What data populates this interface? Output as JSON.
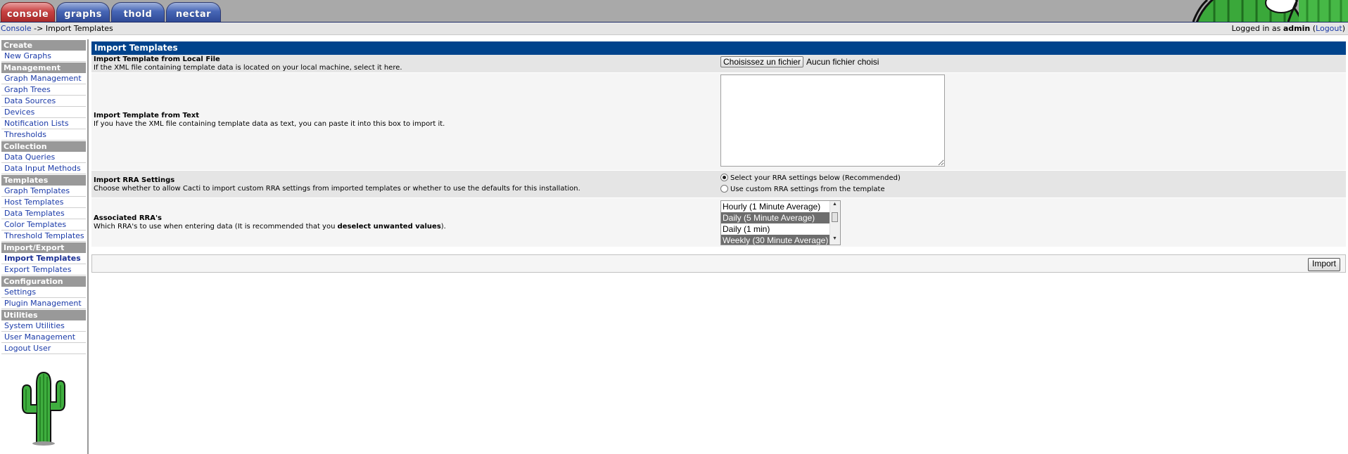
{
  "tabs": [
    {
      "label": "console",
      "color": "#c84242"
    },
    {
      "label": "graphs",
      "color": "#4766b6"
    },
    {
      "label": "thold",
      "color": "#4766b6"
    },
    {
      "label": "nectar",
      "color": "#4766b6"
    }
  ],
  "breadcrumb": {
    "root": "Console",
    "separator": " -> ",
    "current": "Import Templates"
  },
  "session": {
    "prefix": "Logged in as ",
    "user": "admin",
    "logout_open": " (",
    "logout": "Logout",
    "logout_close": ")"
  },
  "sidebar": {
    "sections": [
      {
        "header": "Create",
        "items": [
          "New Graphs"
        ]
      },
      {
        "header": "Management",
        "items": [
          "Graph Management",
          "Graph Trees",
          "Data Sources",
          "Devices",
          "Notification Lists",
          "Thresholds"
        ]
      },
      {
        "header": "Collection Methods",
        "items": [
          "Data Queries",
          "Data Input Methods"
        ]
      },
      {
        "header": "Templates",
        "items": [
          "Graph Templates",
          "Host Templates",
          "Data Templates",
          "Color Templates",
          "Threshold Templates"
        ]
      },
      {
        "header": "Import/Export",
        "items": [
          "Import Templates",
          "Export Templates"
        ]
      },
      {
        "header": "Configuration",
        "items": [
          "Settings",
          "Plugin Management"
        ]
      },
      {
        "header": "Utilities",
        "items": [
          "System Utilities",
          "User Management",
          "Logout User"
        ]
      }
    ],
    "active": "Import Templates"
  },
  "panel": {
    "title": "Import Templates",
    "local_file": {
      "title": "Import Template from Local File",
      "desc": "If the XML file containing template data is located on your local machine, select it here.",
      "button": "Choisissez un fichier",
      "status": "Aucun fichier choisi"
    },
    "text": {
      "title": "Import Template from Text",
      "desc": "If you have the XML file containing template data as text, you can paste it into this box to import it.",
      "value": ""
    },
    "rra_settings": {
      "title": "Import RRA Settings",
      "desc": "Choose whether to allow Cacti to import custom RRA settings from imported templates or whether to use the defaults for this installation.",
      "options": [
        "Select your RRA settings below (Recommended)",
        "Use custom RRA settings from the template"
      ],
      "selected": 0
    },
    "associated_rras": {
      "title": "Associated RRA's",
      "desc_prefix": "Which RRA's to use when entering data (It is recommended that you ",
      "desc_bold": "deselect unwanted values",
      "desc_suffix": ").",
      "options": [
        {
          "label": "Hourly (1 Minute Average)",
          "selected": false
        },
        {
          "label": "Daily (5 Minute Average)",
          "selected": true
        },
        {
          "label": "Daily (1 min)",
          "selected": false
        },
        {
          "label": "Weekly (30 Minute Average)",
          "selected": true
        }
      ]
    },
    "import_button": "Import"
  },
  "colors": {
    "header_blue": "#00438c",
    "sidebar_header": "#999999",
    "link": "#1a3aa8"
  }
}
